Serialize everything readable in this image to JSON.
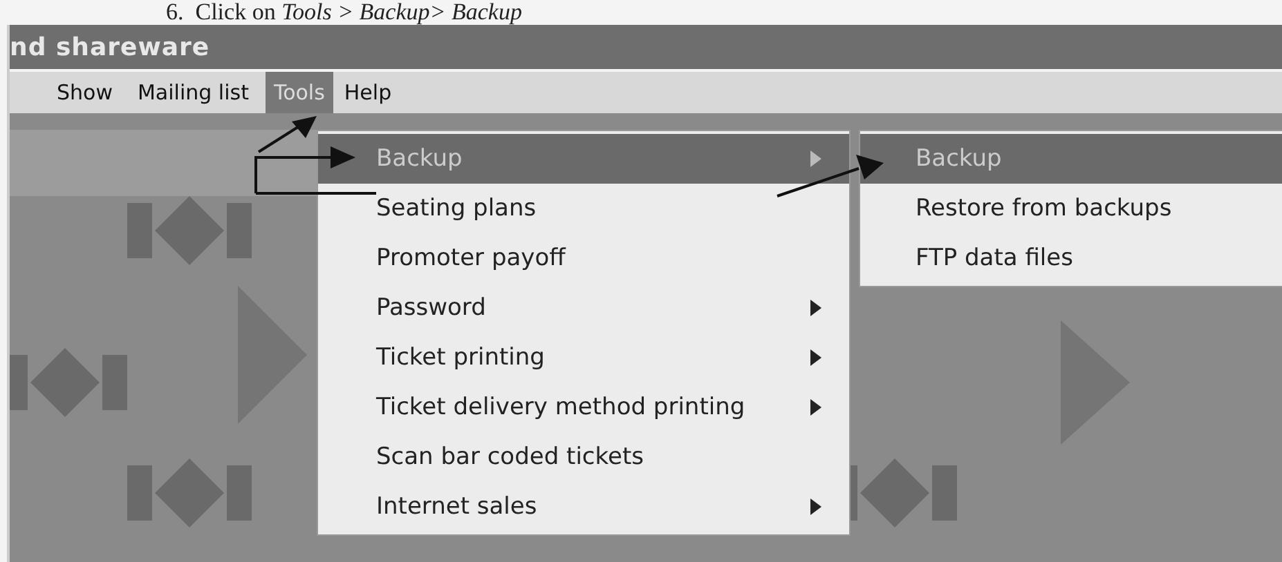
{
  "caption": {
    "number": "6.",
    "text": "Click on",
    "path": "Tools > Backup> Backup"
  },
  "window": {
    "title": "nd shareware"
  },
  "menu_bar": [
    {
      "label": "Show",
      "selected": false
    },
    {
      "label": "Mailing list",
      "selected": false
    },
    {
      "label": "Tools",
      "selected": true
    },
    {
      "label": "Help",
      "selected": false
    }
  ],
  "tools_menu": [
    {
      "label": "Backup",
      "selected": true,
      "submenu": true
    },
    {
      "label": "Seating plans",
      "selected": false,
      "submenu": false
    },
    {
      "label": "Promoter payoff",
      "selected": false,
      "submenu": false
    },
    {
      "label": "Password",
      "selected": false,
      "submenu": true
    },
    {
      "label": "Ticket printing",
      "selected": false,
      "submenu": true
    },
    {
      "label": "Ticket delivery method printing",
      "selected": false,
      "submenu": true
    },
    {
      "label": "Scan bar coded tickets",
      "selected": false,
      "submenu": false
    },
    {
      "label": "Internet sales",
      "selected": false,
      "submenu": true
    }
  ],
  "backup_submenu": [
    {
      "label": "Backup",
      "selected": true
    },
    {
      "label": "Restore from backups",
      "selected": false
    },
    {
      "label": "FTP data files",
      "selected": false
    }
  ]
}
